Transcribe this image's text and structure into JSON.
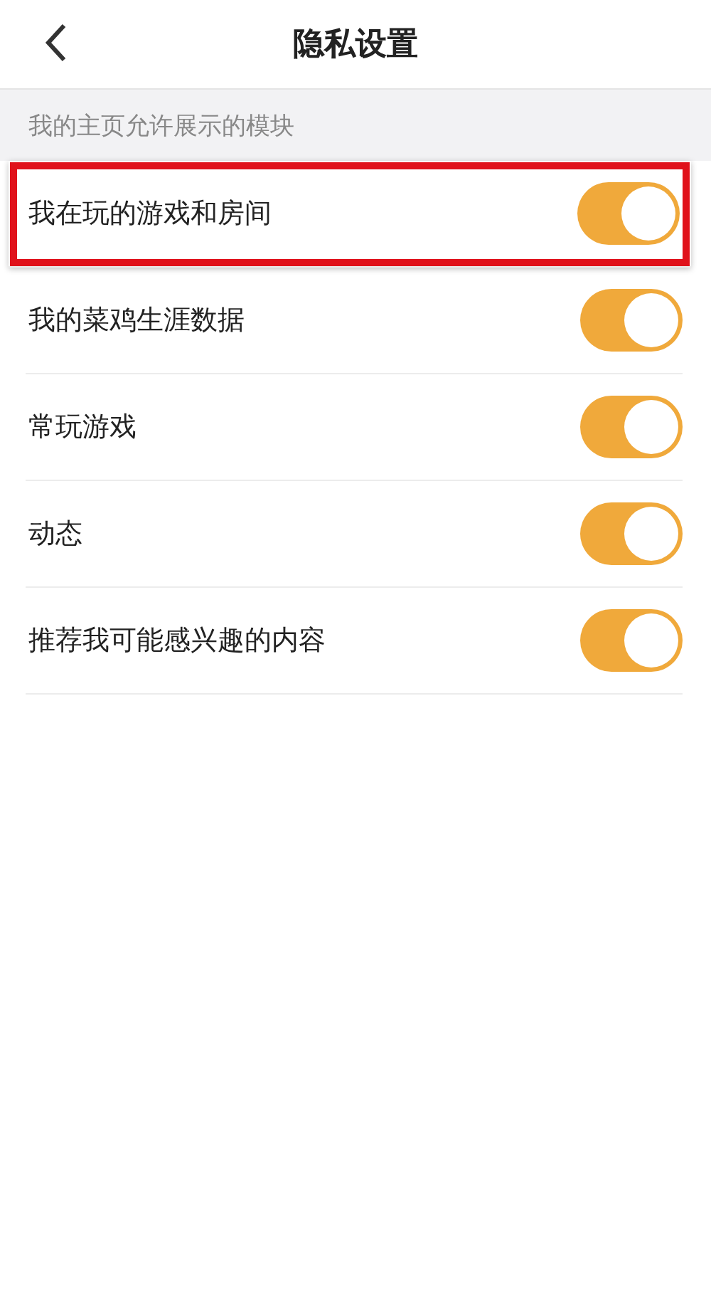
{
  "header": {
    "title": "隐私设置"
  },
  "section": {
    "title": "我的主页允许展示的模块"
  },
  "rows": [
    {
      "label": "我在玩的游戏和房间",
      "on": true,
      "highlighted": true
    },
    {
      "label": "我的菜鸡生涯数据",
      "on": true,
      "highlighted": false
    },
    {
      "label": "常玩游戏",
      "on": true,
      "highlighted": false
    },
    {
      "label": "动态",
      "on": true,
      "highlighted": false
    },
    {
      "label": "推荐我可能感兴趣的内容",
      "on": true,
      "highlighted": false
    }
  ]
}
